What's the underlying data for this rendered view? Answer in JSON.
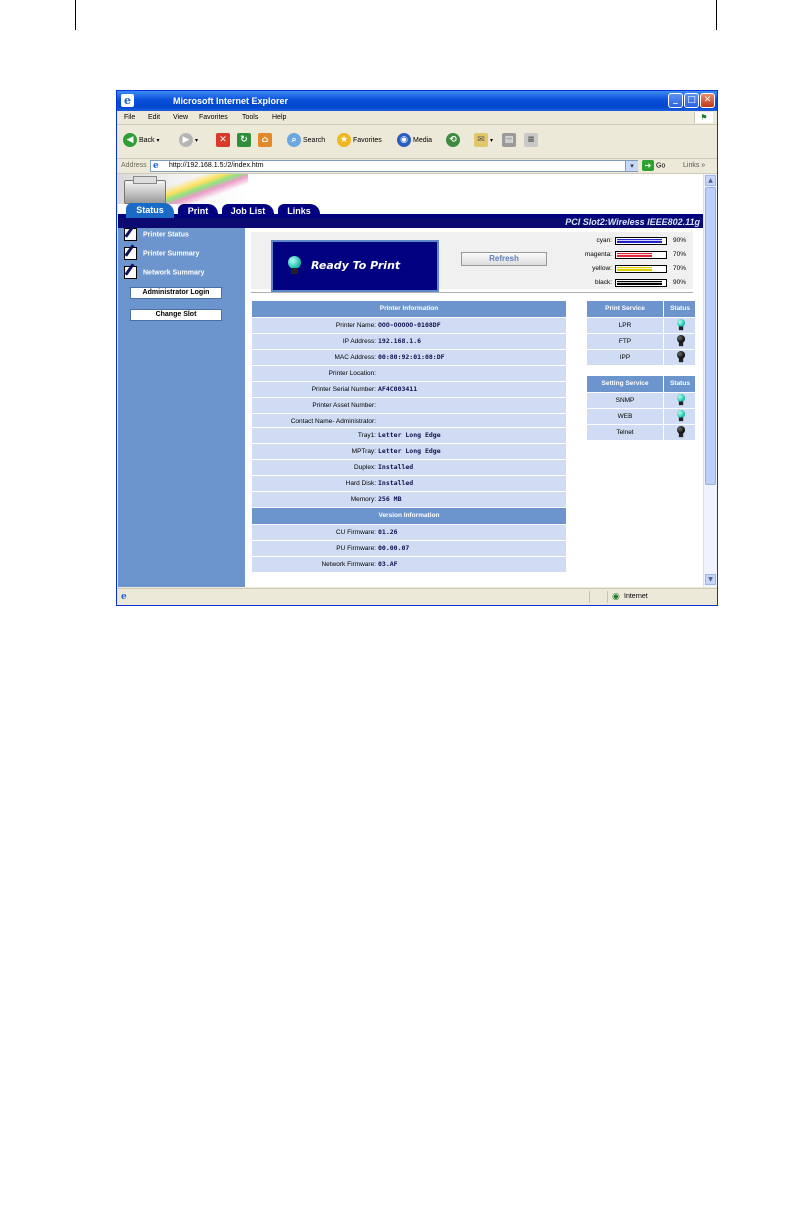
{
  "window": {
    "title": "Microsoft Internet Explorer"
  },
  "menu": [
    "File",
    "Edit",
    "View",
    "Favorites",
    "Tools",
    "Help"
  ],
  "toolbar": {
    "back": "Back",
    "search": "Search",
    "favorites": "Favorites",
    "media": "Media"
  },
  "address": {
    "label": "Address",
    "url": "http://192.168.1.5:/2/index.htm",
    "go": "Go",
    "links": "Links"
  },
  "status_bar": {
    "zone": "Internet"
  },
  "tabs": [
    "Status",
    "Print",
    "Job List",
    "Links"
  ],
  "subtitle": "PCI Slot2:Wireless IEEE802.11g",
  "sidebar": {
    "links": [
      "Printer Status",
      "Printer Summary",
      "Network Summary"
    ],
    "buttons": [
      "Administrator Login",
      "Change Slot"
    ]
  },
  "status": {
    "text": "Ready To Print",
    "refresh": "Refresh"
  },
  "toner": [
    {
      "name": "cyan:",
      "percent": 90,
      "label": "90%",
      "color": "#2222cc"
    },
    {
      "name": "magenta:",
      "percent": 70,
      "label": "70%",
      "color": "#e02838"
    },
    {
      "name": "yellow:",
      "percent": 70,
      "label": "70%",
      "color": "#e0d000"
    },
    {
      "name": "black:",
      "percent": 90,
      "label": "90%",
      "color": "#000000"
    }
  ],
  "printer_info": {
    "header": "Printer Information",
    "rows": [
      {
        "label": "Printer Name:",
        "value": "OOO-OOOOO-0108DF"
      },
      {
        "label": "IP Address:",
        "value": "192.168.1.6"
      },
      {
        "label": "MAC Address:",
        "value": "00:80:92:01:08:DF"
      },
      {
        "label": "Printer Location:",
        "value": ""
      },
      {
        "label": "Printer Serial Number:",
        "value": "AF4C003411"
      },
      {
        "label": "Printer Asset Number:",
        "value": ""
      },
      {
        "label": "Contact Name- Administrator:",
        "value": ""
      }
    ]
  },
  "hardware": [
    {
      "label": "Tray1:",
      "value": "Letter Long Edge"
    },
    {
      "label": "MPTray:",
      "value": "Letter Long Edge"
    },
    {
      "label": "Duplex:",
      "value": "Installed"
    },
    {
      "label": "Hard Disk:",
      "value": "Installed"
    },
    {
      "label": "Memory:",
      "value": "256 MB"
    }
  ],
  "version_info": {
    "header": "Version Information",
    "rows": [
      {
        "label": "CU Firmware:",
        "value": "01.26"
      },
      {
        "label": "PU Firmware:",
        "value": "00.00.07"
      },
      {
        "label": "Network Firmware:",
        "value": "03.AF"
      }
    ]
  },
  "print_service": {
    "header": "Print Service",
    "status_header": "Status",
    "rows": [
      {
        "name": "LPR",
        "on": true
      },
      {
        "name": "FTP",
        "on": false
      },
      {
        "name": "IPP",
        "on": false
      }
    ]
  },
  "setting_service": {
    "header": "Setting Service",
    "status_header": "Status",
    "rows": [
      {
        "name": "SNMP",
        "on": true
      },
      {
        "name": "WEB",
        "on": true
      },
      {
        "name": "Telnet",
        "on": false
      }
    ]
  }
}
